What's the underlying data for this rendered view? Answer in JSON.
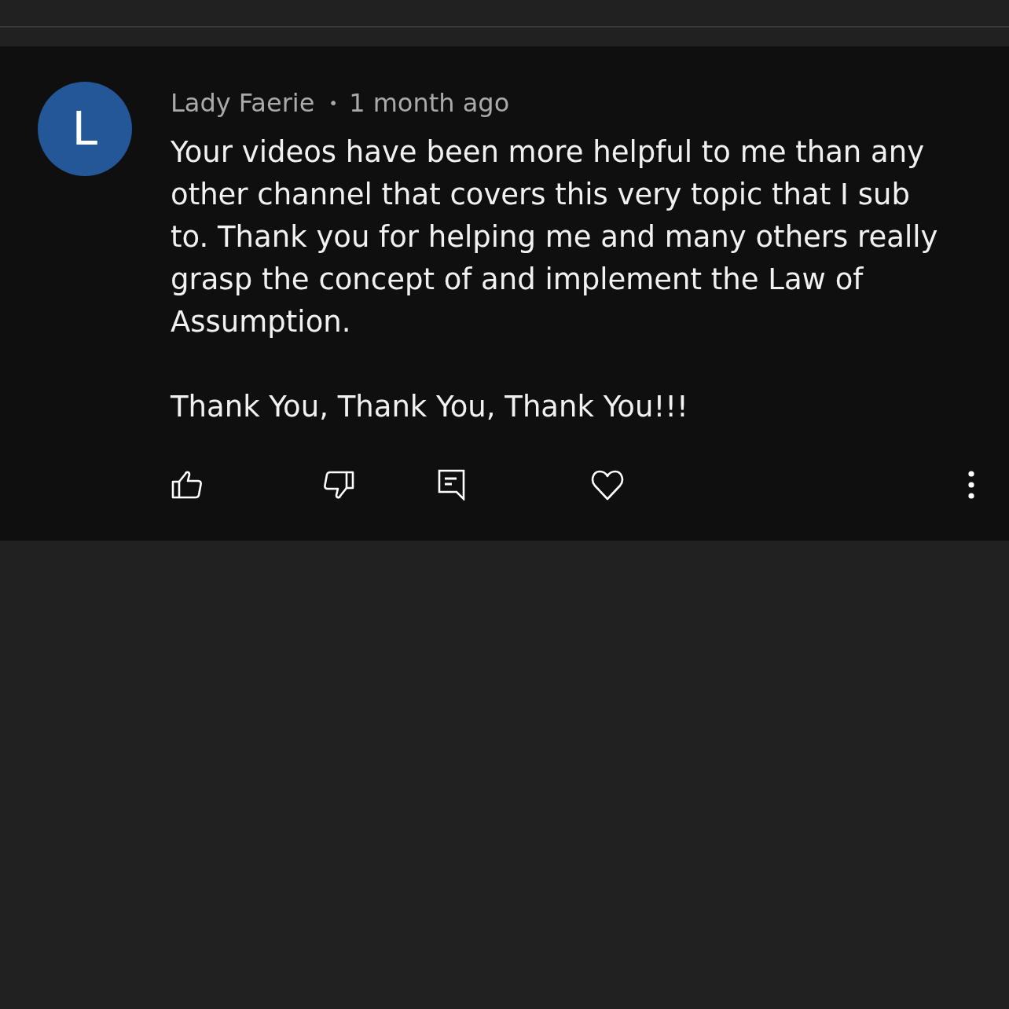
{
  "comment": {
    "avatar": {
      "letter": "L"
    },
    "author": "Lady Faerie",
    "separator": "•",
    "time": "1 month ago",
    "body": [
      "Your videos have been more helpful to me than any other channel that covers this very topic that I sub to. Thank you for helping me and many others really grasp the concept of and implement the Law of Assumption.",
      "Thank You, Thank You, Thank You!!!"
    ],
    "actions": [
      {
        "kind": "like"
      },
      {
        "kind": "dislike"
      },
      {
        "kind": "reply"
      },
      {
        "kind": "heart"
      },
      {
        "kind": "more"
      }
    ]
  }
}
